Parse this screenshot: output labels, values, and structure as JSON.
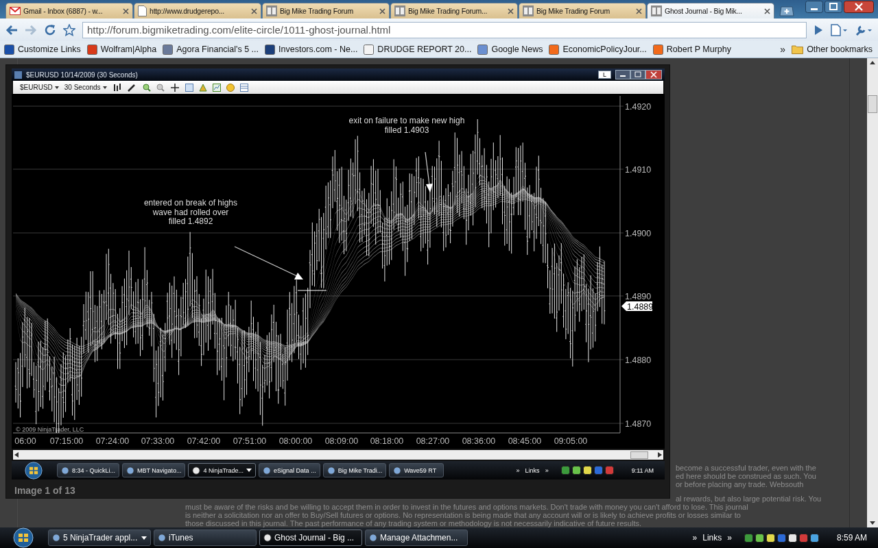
{
  "browser": {
    "tabs": [
      {
        "label": "Gmail - Inbox (6887) - w...",
        "kind": "mail",
        "selected": false
      },
      {
        "label": "http://www.drudgerepo...",
        "kind": "page",
        "selected": false
      },
      {
        "label": "Big Mike Trading Forum",
        "kind": "forum",
        "selected": false
      },
      {
        "label": "Big Mike Trading Forum...",
        "kind": "forum",
        "selected": false
      },
      {
        "label": "Big Mike Trading Forum",
        "kind": "forum",
        "selected": false
      },
      {
        "label": "Ghost Journal - Big Mik...",
        "kind": "forum",
        "selected": true
      }
    ],
    "address": "http://forum.bigmiketrading.com/elite-circle/1011-ghost-journal.html",
    "bookmarks": [
      {
        "label": "Customize Links",
        "color": "#1a4fa8"
      },
      {
        "label": "Wolfram|Alpha",
        "color": "#d83a1a"
      },
      {
        "label": "Agora Financial's 5 ...",
        "color": "#6a7a9a"
      },
      {
        "label": "Investors.com - Ne...",
        "color": "#1c3f7a"
      },
      {
        "label": "DRUDGE REPORT 20...",
        "color": "#f4f4f4"
      },
      {
        "label": "Google News",
        "color": "#6a8fd0"
      },
      {
        "label": "EconomicPolicyJour...",
        "color": "#f26a1b"
      },
      {
        "label": "Robert P Murphy",
        "color": "#f26a1b"
      }
    ],
    "bookmarks_overflow": "»",
    "other_bookmarks": "Other bookmarks"
  },
  "lightbox": {
    "screenshot": {
      "window_title": "$EURUSD 10/14/2009 (30 Seconds)",
      "title_button": "L",
      "instrument": "$EURUSD",
      "interval": "30 Seconds",
      "chart": {
        "y_labels": [
          "1.4920",
          "1.4910",
          "1.4900",
          "1.4890",
          "1.4880",
          "1.4870"
        ],
        "x_labels": [
          "06:00",
          "07:15:00",
          "07:24:00",
          "07:33:00",
          "07:42:00",
          "07:51:00",
          "08:00:00",
          "08:09:00",
          "08:18:00",
          "08:27:00",
          "08:36:00",
          "08:45:00",
          "09:05:00"
        ],
        "last_price": "1.4889",
        "annotations": [
          "entered on break of highs\nwave had rolled over\nfilled 1.4892",
          "exit on failure to make new high\nfilled 1.4903"
        ],
        "copyright": "© 2009 NinjaTrader, LLC"
      },
      "taskbar": {
        "buttons": [
          {
            "label": "8:34 - QuickLi...",
            "grouped": false,
            "selected": false
          },
          {
            "label": "MBT Navigato...",
            "grouped": false,
            "selected": false
          },
          {
            "label": "4 NinjaTrade...",
            "grouped": true,
            "selected": true
          },
          {
            "label": "eSignal Data ...",
            "grouped": false,
            "selected": false
          },
          {
            "label": "Big Mike Tradi...",
            "grouped": false,
            "selected": false
          },
          {
            "label": "Wave59 RT",
            "grouped": false,
            "selected": false
          }
        ],
        "chevron_before": "»",
        "links": "Links",
        "chevron_after": "»",
        "clock": "9:11 AM"
      }
    },
    "caption": "Image 1 of 13"
  },
  "page_text": {
    "right_lines": [
      "become a successful trader, even with the",
      "ed here should be construed as such. You",
      "or before placing any trade. Websouth",
      "al rewards, but also large potential risk. You"
    ],
    "lines": [
      "must be aware of the risks and be willing to accept them in order to invest in the futures and options markets. Don't trade with money you can't afford to lose. This journal",
      "is neither a solicitation nor an offer to Buy/Sell futures or options. No representation is being made that any account will or is likely to achieve profits or losses similar to",
      "those discussed in this journal. The past performance of any trading system or methodology is not necessarily indicative of future results."
    ]
  },
  "taskbar": {
    "buttons": [
      {
        "label": "5 NinjaTrader appl...",
        "grouped": true,
        "selected": false
      },
      {
        "label": "iTunes",
        "grouped": false,
        "selected": false
      },
      {
        "label": "Ghost Journal - Big ...",
        "grouped": false,
        "selected": true
      },
      {
        "label": "Manage Attachmen...",
        "grouped": false,
        "selected": false
      }
    ],
    "chevron_before": "»",
    "links": "Links",
    "chevron_after": "»",
    "clock": "8:59 AM"
  }
}
